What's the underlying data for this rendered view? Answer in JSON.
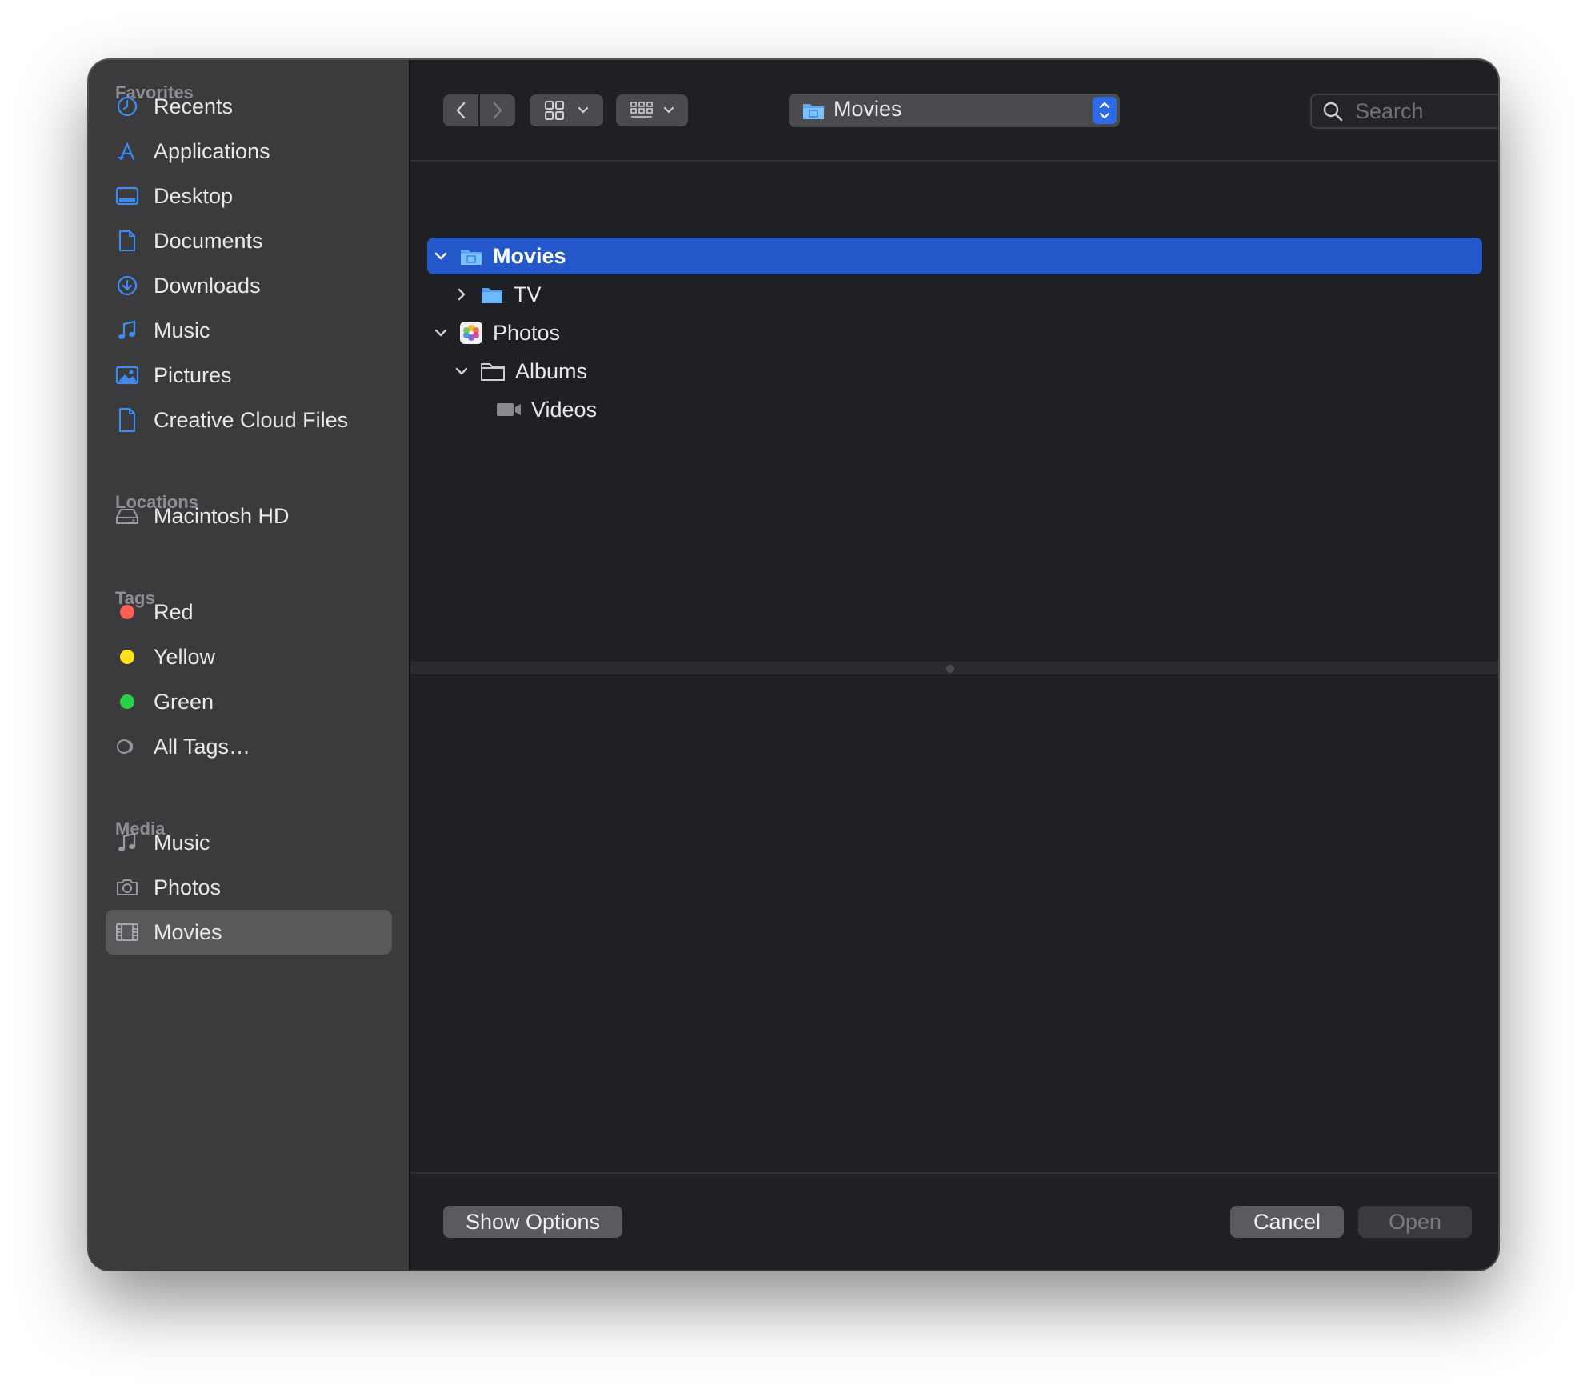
{
  "sidebar": {
    "favorites_title": "Favorites",
    "favorites": [
      {
        "label": "Recents",
        "icon": "clock-icon"
      },
      {
        "label": "Applications",
        "icon": "applications-icon"
      },
      {
        "label": "Desktop",
        "icon": "desktop-icon"
      },
      {
        "label": "Documents",
        "icon": "document-icon"
      },
      {
        "label": "Downloads",
        "icon": "download-icon"
      },
      {
        "label": "Music",
        "icon": "music-note-icon"
      },
      {
        "label": "Pictures",
        "icon": "pictures-icon"
      },
      {
        "label": "Creative Cloud Files",
        "icon": "file-icon"
      }
    ],
    "locations_title": "Locations",
    "locations": [
      {
        "label": "Macintosh HD",
        "icon": "disk-icon"
      }
    ],
    "tags_title": "Tags",
    "tags": [
      {
        "label": "Red",
        "color": "#ff5f57"
      },
      {
        "label": "Yellow",
        "color": "#ffe01a"
      },
      {
        "label": "Green",
        "color": "#29d148"
      },
      {
        "label": "All Tags…",
        "icon": "all-tags-icon"
      }
    ],
    "media_title": "Media",
    "media": [
      {
        "label": "Music",
        "icon": "music-note-icon"
      },
      {
        "label": "Photos",
        "icon": "camera-icon"
      },
      {
        "label": "Movies",
        "icon": "film-icon",
        "selected": true
      }
    ]
  },
  "toolbar": {
    "path_label": "Movies",
    "search_placeholder": "Search"
  },
  "tree": [
    {
      "label": "Movies",
      "expanded": true,
      "selected": true,
      "depth": 0,
      "icon": "movies-folder-icon"
    },
    {
      "label": "TV",
      "expanded": false,
      "depth": 1,
      "icon": "folder-icon"
    },
    {
      "label": "Photos",
      "expanded": true,
      "depth": 0,
      "icon": "photos-app-icon"
    },
    {
      "label": "Albums",
      "expanded": true,
      "depth": 1,
      "icon": "folder-outline-icon"
    },
    {
      "label": "Videos",
      "depth": 2,
      "icon": "video-icon"
    }
  ],
  "footer": {
    "show_options": "Show Options",
    "cancel": "Cancel",
    "open": "Open"
  },
  "colors": {
    "accent": "#2457c9",
    "sidebar_icon": "#3b8cf5"
  }
}
